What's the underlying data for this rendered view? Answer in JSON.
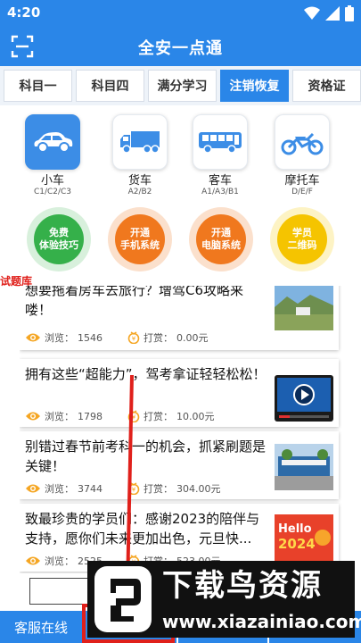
{
  "status_bar": {
    "time": "4:20"
  },
  "app_bar": {
    "title": "全安一点通"
  },
  "tabs": [
    {
      "label": "科目一",
      "active": false
    },
    {
      "label": "科目四",
      "active": false
    },
    {
      "label": "满分学习",
      "active": false
    },
    {
      "label": "注销恢复",
      "active": true
    },
    {
      "label": "资格证",
      "active": false
    }
  ],
  "vehicles": [
    {
      "name": "小车",
      "sub": "C1/C2/C3",
      "icon": "car-icon",
      "active": true
    },
    {
      "name": "货车",
      "sub": "A2/B2",
      "icon": "truck-icon",
      "active": false
    },
    {
      "name": "客车",
      "sub": "A1/A3/B1",
      "icon": "bus-icon",
      "active": false
    },
    {
      "name": "摩托车",
      "sub": "D/E/F",
      "icon": "motorcycle-icon",
      "active": false
    }
  ],
  "features": [
    {
      "line1": "免费",
      "line2": "体验技巧",
      "color": "#35b04a"
    },
    {
      "line1": "开通",
      "line2": "手机系统",
      "color": "#f0781e"
    },
    {
      "line1": "开通",
      "line2": "电脑系统",
      "color": "#f0781e"
    },
    {
      "line1": "学员",
      "line2": "二维码",
      "color": "#f5c400"
    }
  ],
  "section_label": "试题库",
  "news": [
    {
      "title": "想要拖着房车去旅行？增驾C6攻略来喽！",
      "views_label": "浏览：",
      "views": "1546",
      "reward_label": "打赏：",
      "reward": "0.00元",
      "thumb": "landscape-thumbnail"
    },
    {
      "title": "拥有这些“超能力”，驾考拿证轻轻松松！",
      "views_label": "浏览：",
      "views": "1798",
      "reward_label": "打赏：",
      "reward": "10.00元",
      "thumb": "video-thumbnail"
    },
    {
      "title": "别错过春节前考科一的机会，抓紧刷题是关键！",
      "views_label": "浏览：",
      "views": "3744",
      "reward_label": "打赏：",
      "reward": "304.00元",
      "thumb": "building-thumbnail"
    },
    {
      "title": "致最珍贵的学员们：感谢2023的陪伴与支持，愿你们未来更加出色，元旦快...",
      "views_label": "浏览：",
      "views": "2525",
      "reward_label": "打赏：",
      "reward": "523.00元",
      "thumb": "hello-2024-thumbnail",
      "thumb_text1": "Hello",
      "thumb_text2": "2024"
    }
  ],
  "bottom_bar": {
    "service_label": "客服在线"
  },
  "watermark": {
    "title": "下载鸟资源",
    "url": "www.xiazainiao.com"
  },
  "colors": {
    "primary": "#2a86e8",
    "highlight": "#e0201b"
  }
}
